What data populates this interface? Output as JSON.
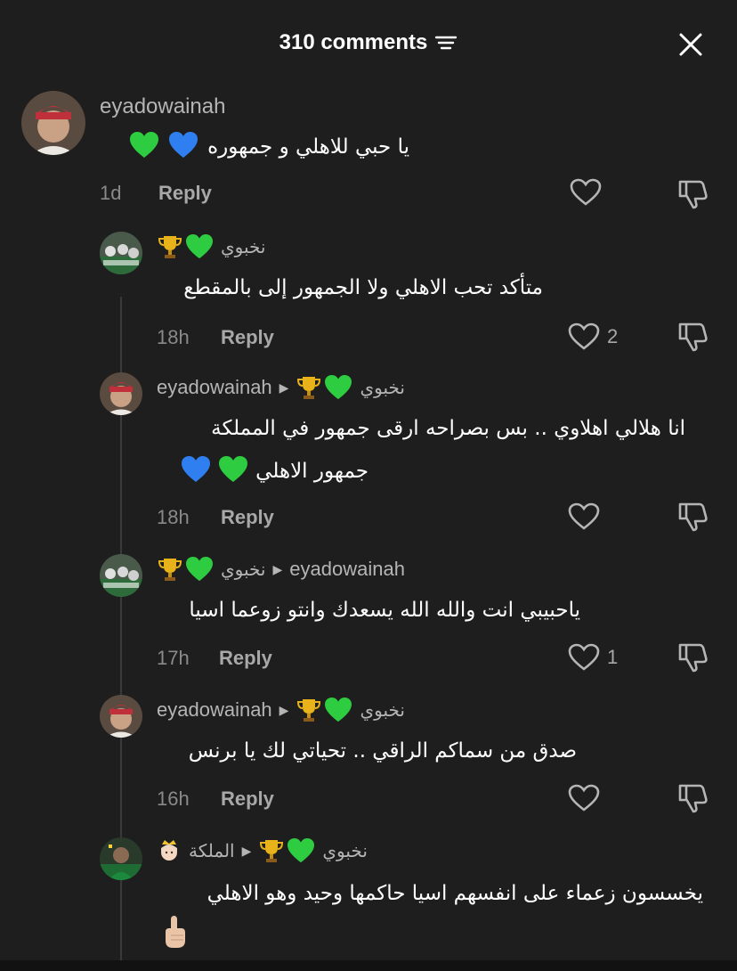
{
  "header": {
    "title": "310 comments"
  },
  "comments": [
    {
      "username": "eyadowainah",
      "text": "يا حبي للاهلي و جمهوره",
      "time": "1d",
      "reply_label": "Reply",
      "likes": ""
    },
    {
      "username": "نخبوي",
      "text": "متأكد تحب الاهلي ولا الجمهور إلى بالمقطع",
      "time": "18h",
      "reply_label": "Reply",
      "likes": "2"
    },
    {
      "username": "eyadowainah",
      "reply_to": "نخبوي",
      "text_line1": "انا هلالي اهلاوي .. بس بصراحه ارقى جمهور في المملكة",
      "text_line2": "جمهور الاهلي",
      "time": "18h",
      "reply_label": "Reply",
      "likes": ""
    },
    {
      "username": "نخبوي",
      "reply_to": "eyadowainah",
      "text": "ياحبيبي انت والله الله يسعدك وانتو زوعما اسيا",
      "time": "17h",
      "reply_label": "Reply",
      "likes": "1"
    },
    {
      "username": "eyadowainah",
      "reply_to": "نخبوي",
      "text": "صدق من سماكم الراقي .. تحياتي لك يا برنس",
      "time": "16h",
      "reply_label": "Reply",
      "likes": ""
    },
    {
      "username": "الملكة",
      "reply_to": "نخبوي",
      "text": "يخسسون زعماء على انفسهم اسيا حاكمها وحيد وهو الاهلي"
    }
  ],
  "colors": {
    "background": "#1e1e1e",
    "text": "#ffffff",
    "muted": "#8a8a8a",
    "green_heart": "#2ecc40",
    "blue_heart": "#2f7ff0"
  }
}
